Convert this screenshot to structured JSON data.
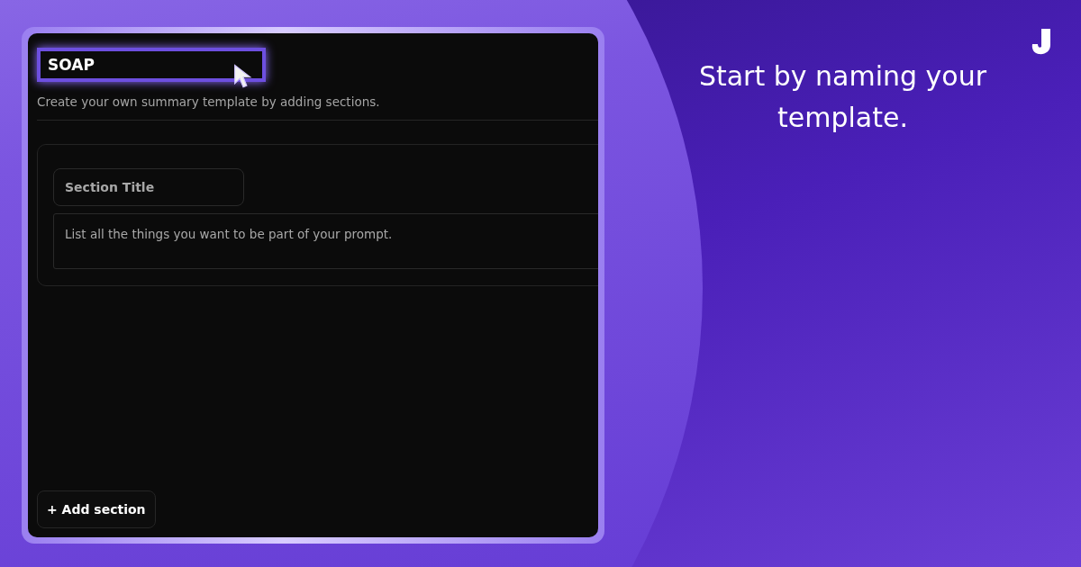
{
  "editor": {
    "template_name": {
      "value": "SOAP",
      "focused": true
    },
    "description": "Create your own summary template by adding sections.",
    "sections": [
      {
        "title_field": {
          "placeholder": "Section Title"
        },
        "prompt_field": {
          "placeholder": "List all the things you want to be part of your prompt."
        }
      }
    ],
    "add_button": "+ Add section"
  },
  "caption": "Start by naming your template."
}
